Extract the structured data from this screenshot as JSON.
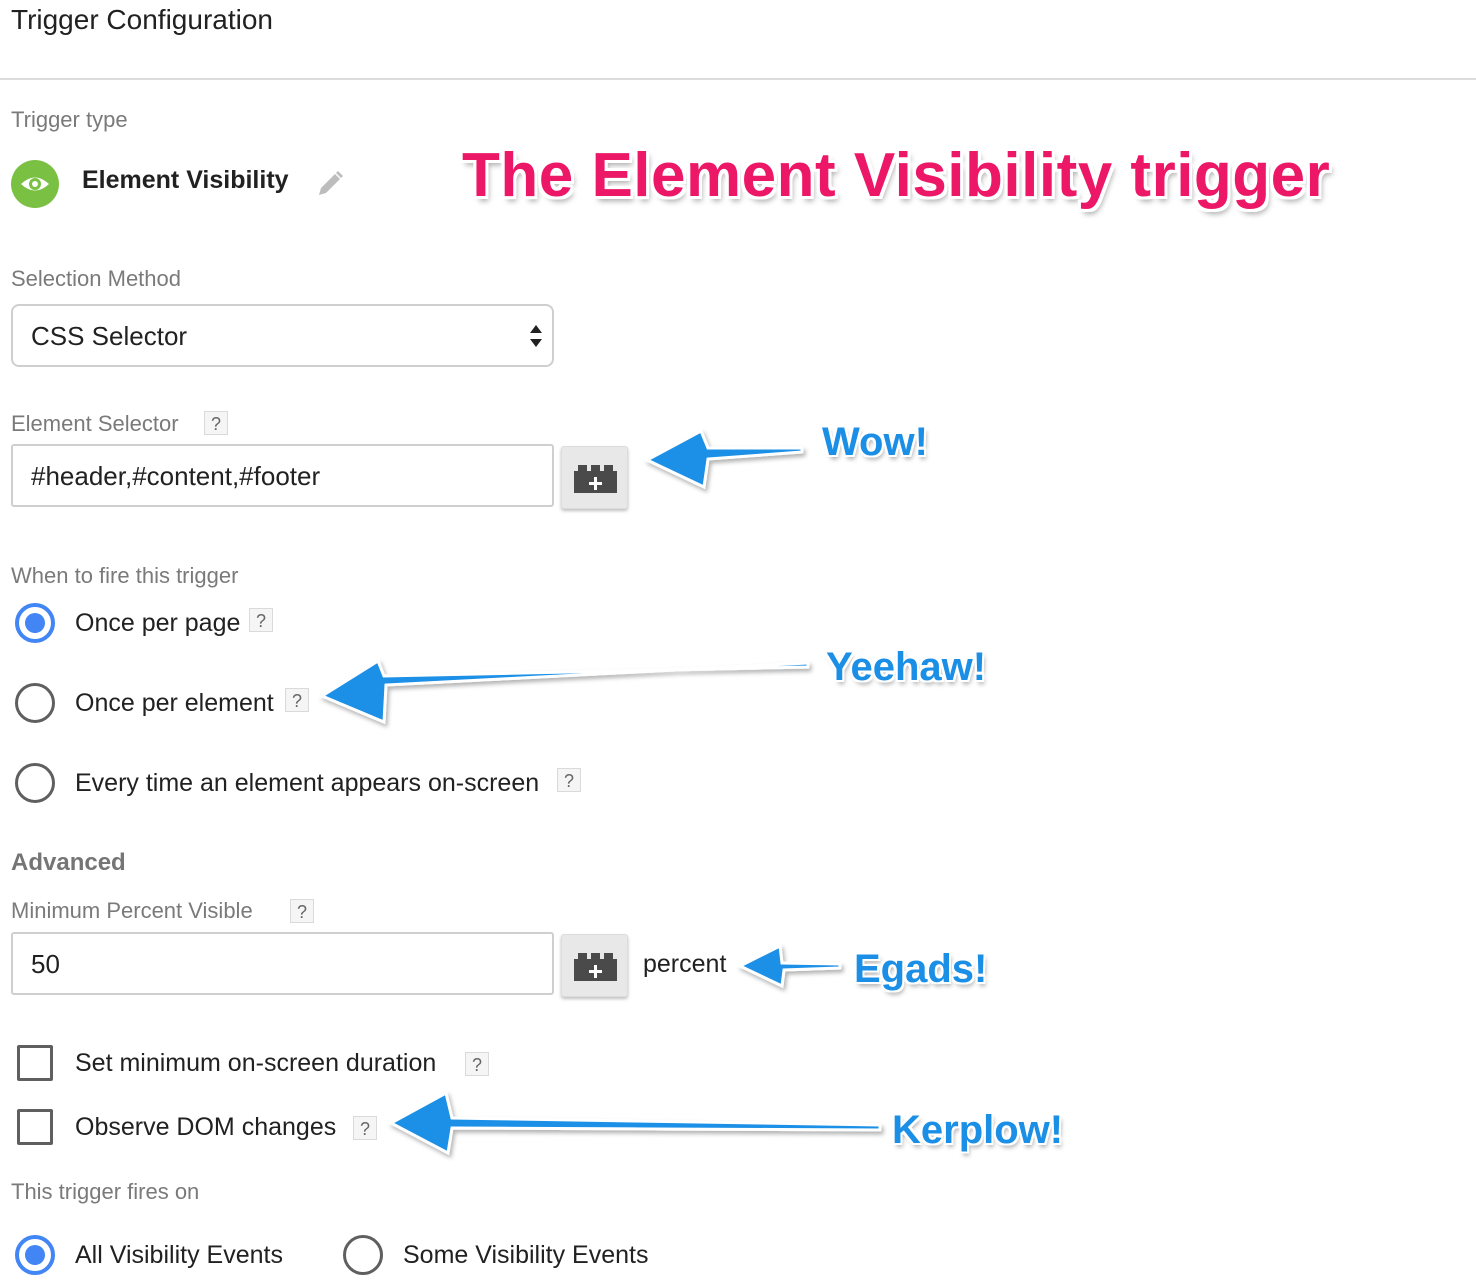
{
  "page": {
    "title": "Trigger Configuration"
  },
  "trigger_type": {
    "label": "Trigger type",
    "name": "Element Visibility",
    "icon": "eye-icon",
    "icon_color": "#7ac143"
  },
  "selection_method": {
    "label": "Selection Method",
    "value": "CSS Selector"
  },
  "element_selector": {
    "label": "Element Selector",
    "help": "?",
    "value": "#header,#content,#footer"
  },
  "fire_when": {
    "label": "When to fire this trigger",
    "options": [
      {
        "label": "Once per page",
        "help": "?",
        "selected": true
      },
      {
        "label": "Once per element",
        "help": "?",
        "selected": false
      },
      {
        "label": "Every time an element appears on-screen",
        "help": "?",
        "selected": false
      }
    ]
  },
  "advanced": {
    "label": "Advanced",
    "min_percent": {
      "label": "Minimum Percent Visible",
      "help": "?",
      "value": "50",
      "suffix": "percent"
    },
    "checkboxes": [
      {
        "label": "Set minimum on-screen duration",
        "help": "?",
        "checked": false
      },
      {
        "label": "Observe DOM changes",
        "help": "?",
        "checked": false
      }
    ]
  },
  "fires_on": {
    "label": "This trigger fires on",
    "options": [
      {
        "label": "All Visibility Events",
        "selected": true
      },
      {
        "label": "Some Visibility Events",
        "selected": false
      }
    ]
  },
  "annotations": {
    "headline": "The Element Visibility trigger",
    "wow": "Wow!",
    "yeehaw": "Yeehaw!",
    "egads": "Egads!",
    "kerplow": "Kerplow!"
  },
  "colors": {
    "accent_blue": "#4285f4",
    "annotation_pink": "#ec1766",
    "annotation_blue": "#1b8fe6"
  }
}
